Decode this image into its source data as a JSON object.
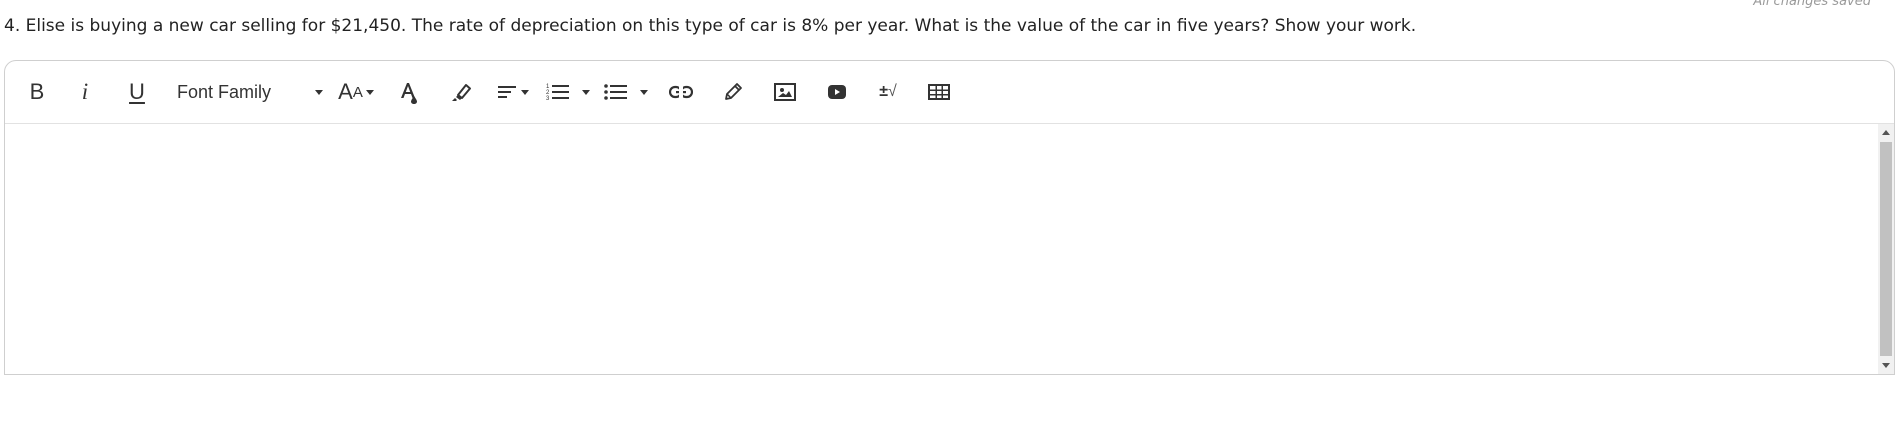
{
  "status": {
    "saved_text": "All changes saved"
  },
  "question": {
    "text": "4. Elise is buying a new car selling for $21,450. The rate of depreciation on this type of car is 8% per year. What is the value of the car in five years? Show your work."
  },
  "toolbar": {
    "bold_label": "B",
    "italic_label": "i",
    "underline_label": "U",
    "font_family_label": "Font Family",
    "font_size_big": "A",
    "font_size_small": "A",
    "formula_label": "±",
    "formula_sqrt": "√"
  },
  "icons": [
    "bold-icon",
    "italic-icon",
    "underline-icon",
    "font-size-icon",
    "text-color-icon",
    "highlight-icon",
    "align-icon",
    "ordered-list-icon",
    "unordered-list-icon",
    "link-icon",
    "draw-icon",
    "image-icon",
    "video-icon",
    "formula-icon",
    "table-icon"
  ],
  "editor": {
    "content": ""
  }
}
